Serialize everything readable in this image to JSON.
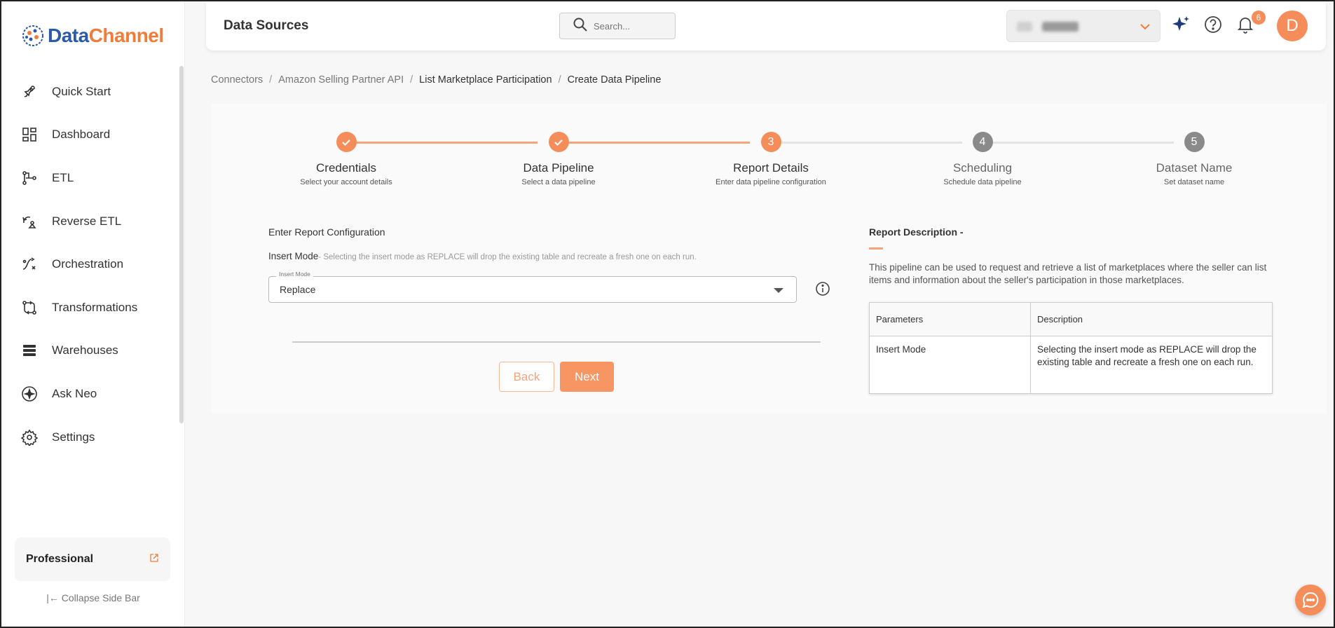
{
  "brand": {
    "name_part1": "Data",
    "name_part2": "Channel"
  },
  "sidebar": {
    "items": [
      {
        "label": "Quick Start",
        "icon": "rocket-icon"
      },
      {
        "label": "Dashboard",
        "icon": "dashboard-icon"
      },
      {
        "label": "ETL",
        "icon": "etl-icon"
      },
      {
        "label": "Reverse ETL",
        "icon": "reverse-etl-icon"
      },
      {
        "label": "Orchestration",
        "icon": "orchestration-icon"
      },
      {
        "label": "Transformations",
        "icon": "transformations-icon"
      },
      {
        "label": "Warehouses",
        "icon": "warehouses-icon"
      },
      {
        "label": "Ask Neo",
        "icon": "sparkle-icon"
      },
      {
        "label": "Settings",
        "icon": "gear-icon"
      }
    ],
    "plan_label": "Professional",
    "collapse_label": "Collapse Side Bar"
  },
  "header": {
    "title": "Data Sources",
    "search_placeholder": "Search...",
    "notification_count": "6",
    "avatar_initial": "D"
  },
  "breadcrumb": [
    "Connectors",
    "Amazon Selling Partner API",
    "List Marketplace Participation",
    "Create Data Pipeline"
  ],
  "stepper": {
    "steps": [
      {
        "number": "1",
        "name": "Credentials",
        "desc": "Select your account details",
        "state": "done"
      },
      {
        "number": "2",
        "name": "Data Pipeline",
        "desc": "Select a data pipeline",
        "state": "done"
      },
      {
        "number": "3",
        "name": "Report Details",
        "desc": "Enter data pipeline configuration",
        "state": "active"
      },
      {
        "number": "4",
        "name": "Scheduling",
        "desc": "Schedule data pipeline",
        "state": "pending"
      },
      {
        "number": "5",
        "name": "Dataset Name",
        "desc": "Set dataset name",
        "state": "pending"
      }
    ]
  },
  "config": {
    "section_title": "Enter Report Configuration",
    "insert_mode_label": "Insert Mode",
    "insert_mode_note": "- Selecting the insert mode as REPLACE will drop the existing table and recreate a fresh one on each run.",
    "field_label": "Insert Mode",
    "field_value": "Replace",
    "back_label": "Back",
    "next_label": "Next"
  },
  "report_description": {
    "title": "Report Description -",
    "text": "This pipeline can be used to request and retrieve a list of marketplaces where the seller can list items and information about the seller's participation in those marketplaces.",
    "columns": [
      "Parameters",
      "Description"
    ],
    "rows": [
      [
        "Insert Mode",
        "Selecting the insert mode as REPLACE will drop the existing table and recreate a fresh one on each run."
      ]
    ]
  },
  "colors": {
    "accent": "#f58d5a",
    "pending": "#8a8a8a",
    "brand_blue": "#2a5aa8"
  }
}
